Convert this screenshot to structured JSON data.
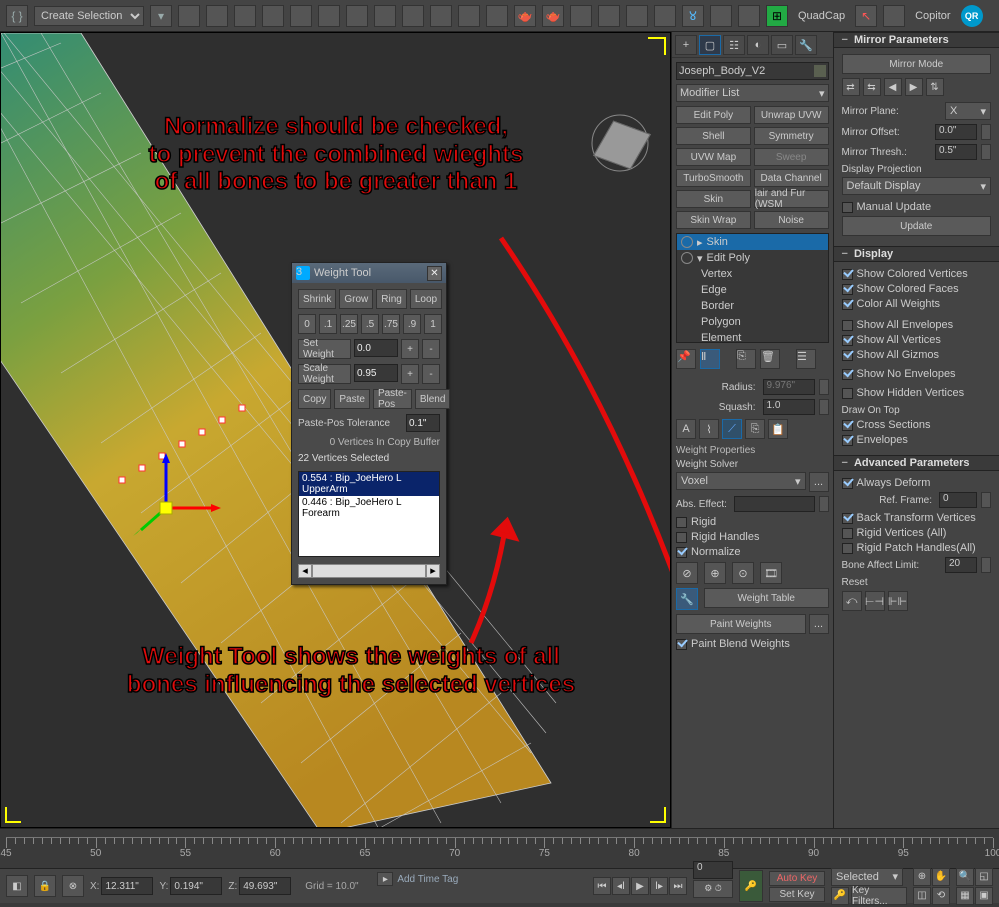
{
  "top_toolbar": {
    "selection_set": "Create Selection Se",
    "quadcap": "QuadCap",
    "copitor": "Copitor"
  },
  "annotations": {
    "normalize": "Normalize should be checked,\nto prevent the combined wieghts\nof all bones to be greater than 1",
    "weight_tool": "Weight Tool shows the weights of all\nbones influencing the selected vertices"
  },
  "weight_tool": {
    "title": "Weight Tool",
    "shrink": "Shrink",
    "grow": "Grow",
    "ring": "Ring",
    "loop": "Loop",
    "presets": [
      "0",
      ".1",
      ".25",
      ".5",
      ".75",
      ".9",
      "1"
    ],
    "set_weight": "Set Weight",
    "set_val": "0.0",
    "scale_weight": "Scale Weight",
    "scale_val": "0.95",
    "copy": "Copy",
    "paste": "Paste",
    "paste_pos": "Paste-Pos",
    "blend": "Blend",
    "tol_label": "Paste-Pos Tolerance",
    "tol_val": "0.1\"",
    "copy_buffer": "0 Vertices In Copy Buffer",
    "selected": "22 Vertices Selected",
    "bones": [
      "0.554 : Bip_JoeHero L UpperArm",
      "0.446 : Bip_JoeHero L Forearm"
    ]
  },
  "cmd": {
    "object_name": "Joseph_Body_V2",
    "modifier_list": "Modifier List",
    "mod_buttons": [
      [
        "Edit Poly",
        "Unwrap UVW"
      ],
      [
        "Shell",
        "Symmetry"
      ],
      [
        "UVW Map",
        "Sweep"
      ],
      [
        "TurboSmooth",
        "Data Channel"
      ],
      [
        "Skin",
        "lair and Fur (WSM"
      ],
      [
        "Skin Wrap",
        "Noise"
      ]
    ],
    "stack": {
      "items": [
        "Skin",
        "Edit Poly",
        "Vertex",
        "Edge",
        "Border",
        "Polygon",
        "Element"
      ]
    },
    "radius_label": "Radius:",
    "radius_val": "9.976\"",
    "squash_label": "Squash:",
    "squash_val": "1.0",
    "weight_props": "Weight Properties",
    "weight_solver": "Weight Solver",
    "solver": "Voxel",
    "solver_ellipsis": "...",
    "abs_effect": "Abs. Effect:",
    "rigid": "Rigid",
    "rigid_handles": "Rigid Handles",
    "normalize": "Normalize",
    "weight_table": "Weight Table",
    "paint_weights": "Paint Weights",
    "paint_ellipsis": "...",
    "paint_blend": "Paint Blend Weights"
  },
  "mirror": {
    "hdr": "Mirror Parameters",
    "mirror_mode": "Mirror Mode",
    "plane_l": "Mirror Plane:",
    "plane_v": "X",
    "offset_l": "Mirror Offset:",
    "offset_v": "0.0\"",
    "thresh_l": "Mirror Thresh.:",
    "thresh_v": "0.5\"",
    "proj_l": "Display Projection",
    "proj_v": "Default Display",
    "manual": "Manual Update",
    "update": "Update"
  },
  "display": {
    "hdr": "Display",
    "show_col_vert": "Show Colored Vertices",
    "show_col_face": "Show Colored Faces",
    "color_all": "Color All Weights",
    "show_env": "Show All Envelopes",
    "show_vert": "Show All Vertices",
    "show_giz": "Show All Gizmos",
    "show_no_env": "Show No Envelopes",
    "show_hidden": "Show Hidden Vertices",
    "draw_top": "Draw On Top",
    "cross": "Cross Sections",
    "envelopes": "Envelopes"
  },
  "adv": {
    "hdr": "Advanced Parameters",
    "always_deform": "Always Deform",
    "ref_frame_l": "Ref. Frame:",
    "ref_frame_v": "0",
    "back_xform": "Back Transform Vertices",
    "rigid_all": "Rigid Vertices (All)",
    "rigid_patch": "Rigid Patch Handles(All)",
    "bone_limit_l": "Bone Affect Limit:",
    "bone_limit_v": "20",
    "reset": "Reset"
  },
  "timeline": {
    "labels": [
      "45",
      "50",
      "55",
      "60",
      "65",
      "70",
      "75",
      "80",
      "85",
      "90",
      "95",
      "100"
    ]
  },
  "status": {
    "x_l": "X:",
    "x_v": "12.311\"",
    "y_l": "Y:",
    "y_v": "0.194\"",
    "z_l": "Z:",
    "z_v": "49.693\"",
    "grid": "Grid = 10.0\"",
    "add_time_tag": "Add Time Tag",
    "frame": "0",
    "auto_key": "Auto Key",
    "set_key": "Set Key",
    "selected": "Selected",
    "key_filters": "Key Filters..."
  }
}
